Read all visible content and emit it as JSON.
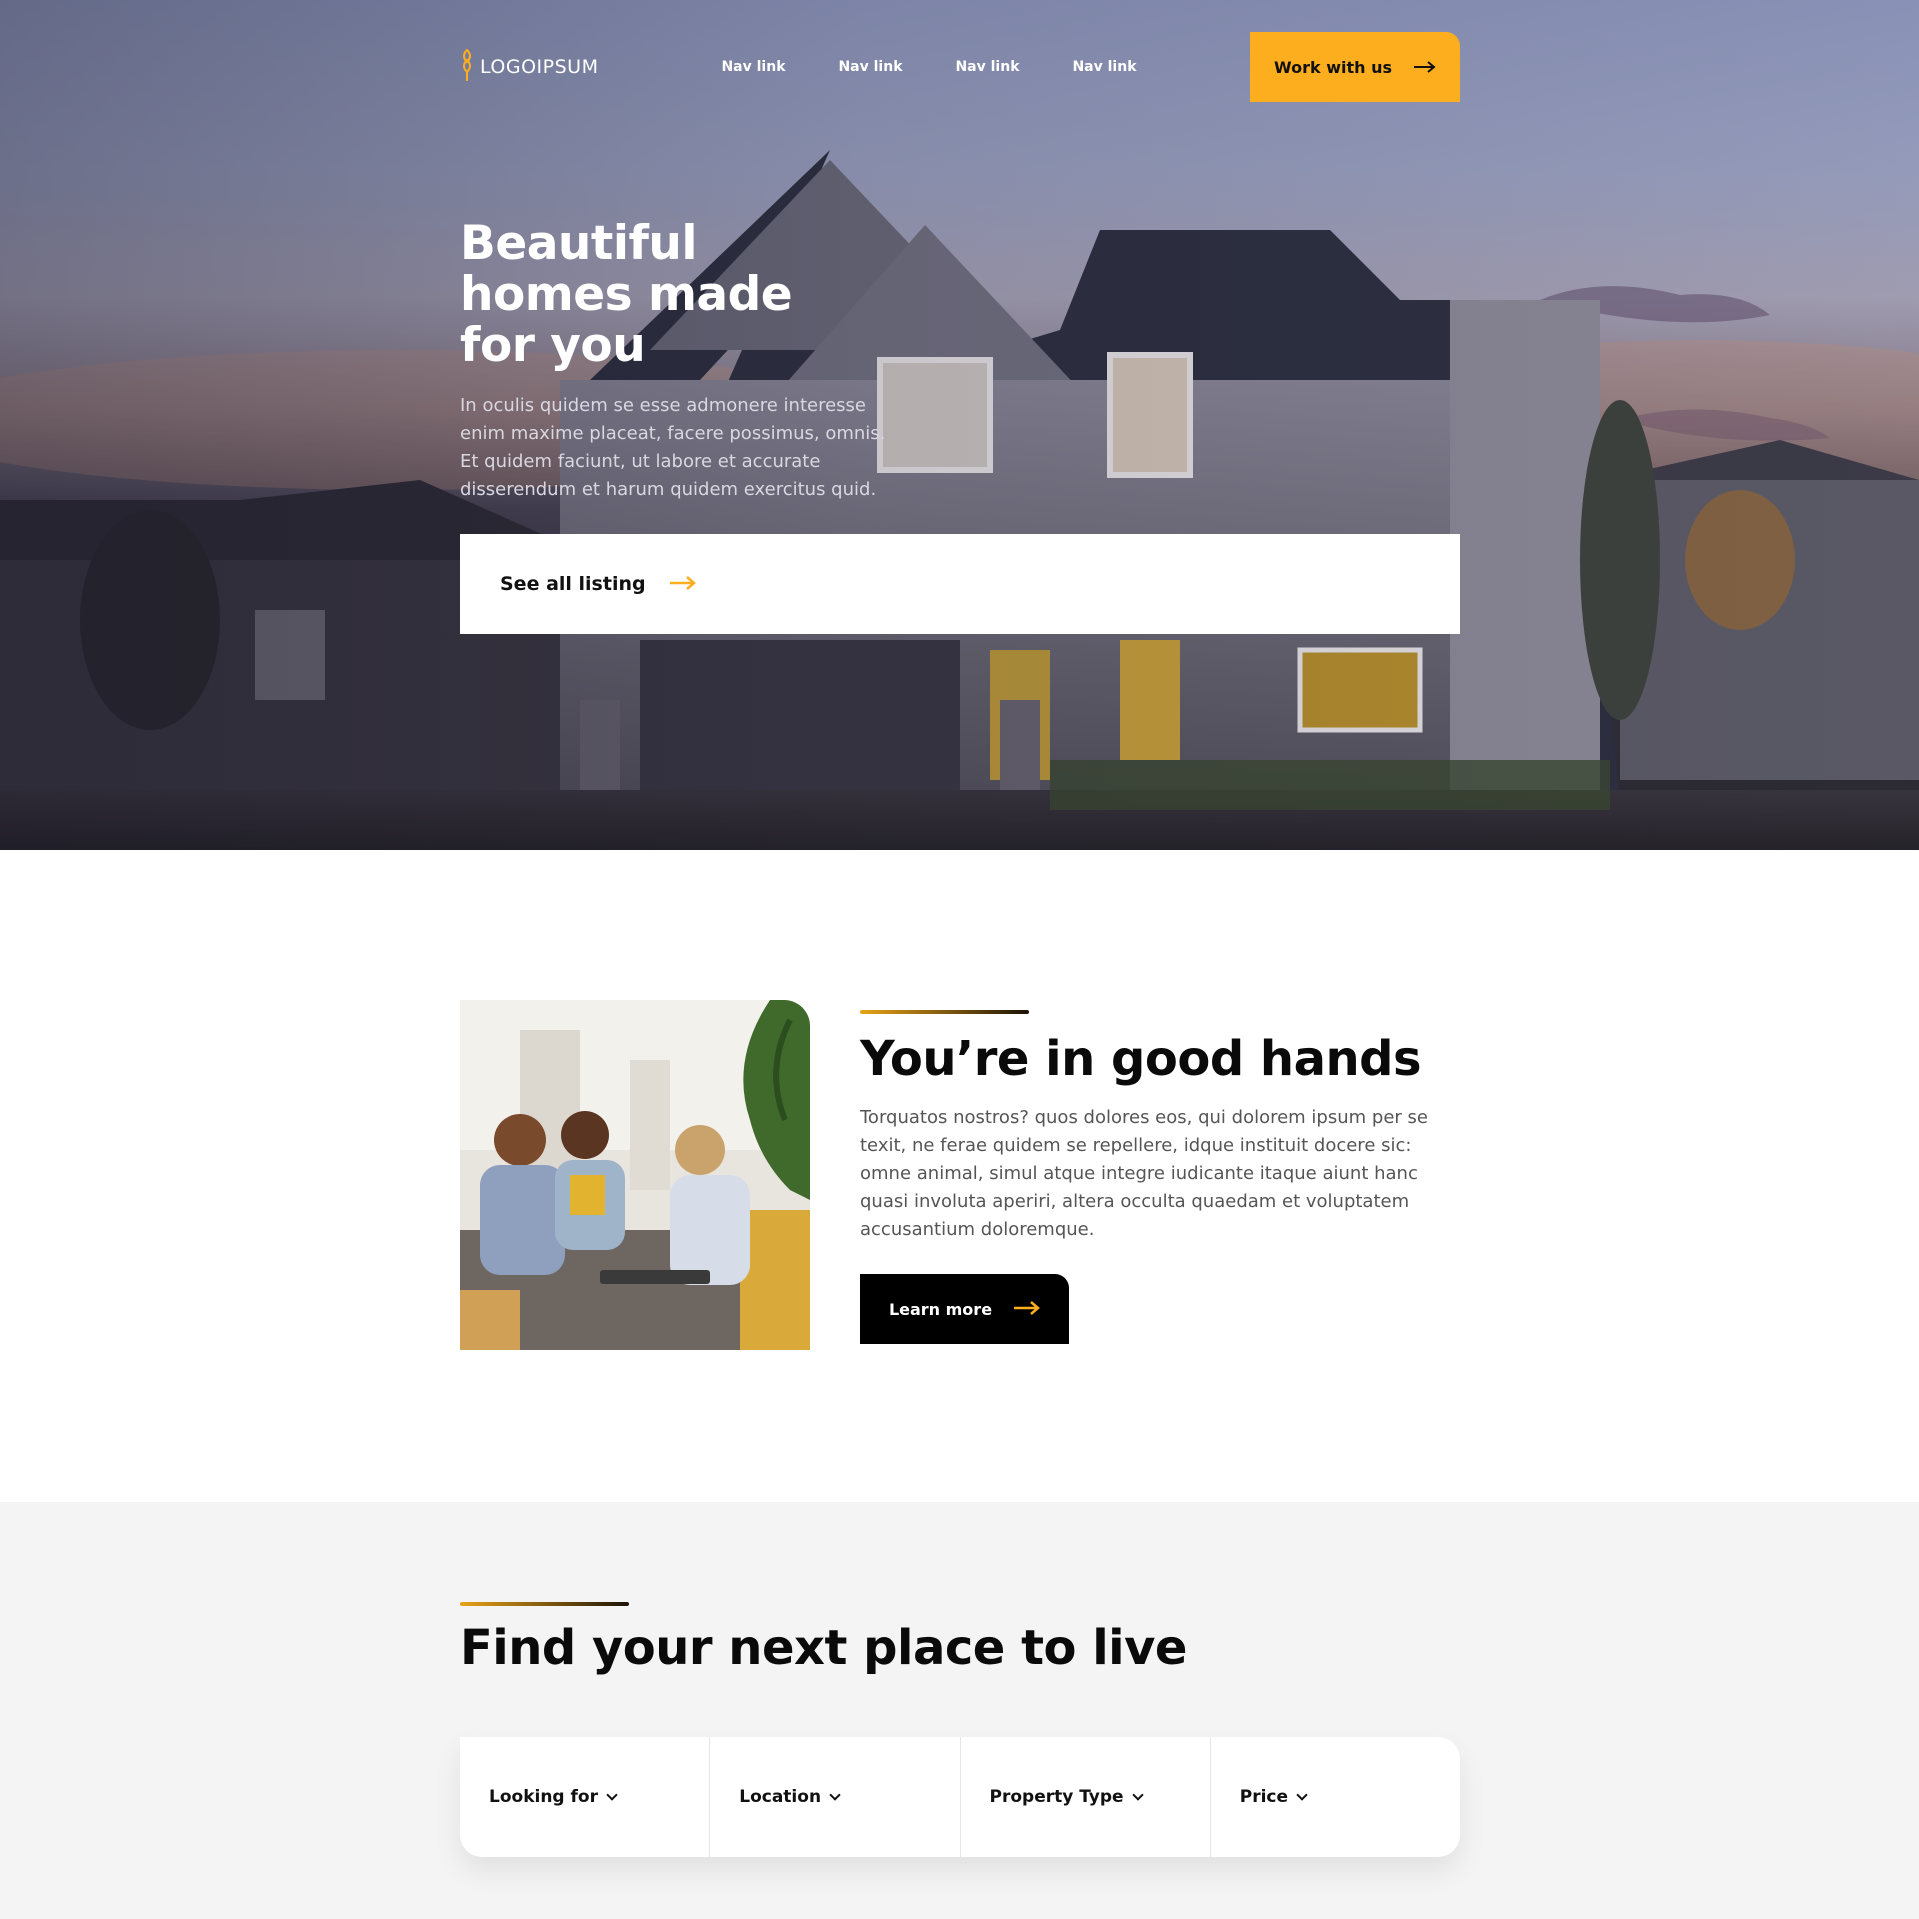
{
  "brand": {
    "name": "LOGOIPSUM",
    "accent_color": "#fcae1e"
  },
  "nav": {
    "links": [
      "Nav link",
      "Nav link",
      "Nav link",
      "Nav link"
    ],
    "cta_label": "Work with us"
  },
  "hero": {
    "title": "Beautiful homes made for you",
    "subtitle": "In oculis quidem se esse admonere interesse enim maxime placeat, facere possimus, omnis. Et quidem faciunt, ut labore et accurate disserendum et harum quidem exercitus quid.",
    "cta_label": "See all listing"
  },
  "about": {
    "title": "You’re in good hands",
    "text": "Torquatos nostros? quos dolores eos, qui dolorem ipsum per se texit, ne ferae quidem se repellere, idque instituit docere sic: omne animal, simul atque integre iudicante itaque aiunt hanc quasi involuta aperiri, altera occulta quaedam et voluptatem accusantium doloremque.",
    "cta_label": "Learn more"
  },
  "search": {
    "title": "Find your next place to live",
    "filters": [
      "Looking for",
      "Location",
      "Property Type",
      "Price"
    ]
  }
}
